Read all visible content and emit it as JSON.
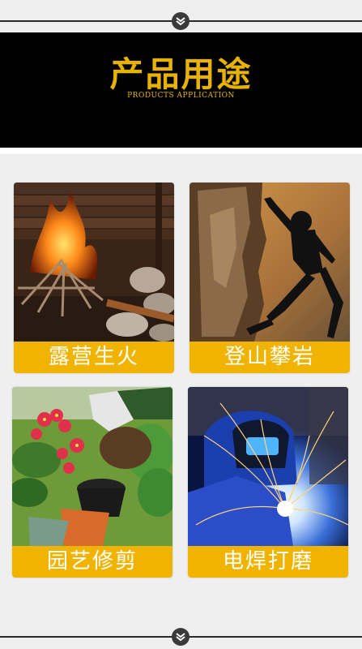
{
  "header": {
    "title": "产品用途",
    "subtitle": "PRODUCTS APPLICATION"
  },
  "cards": [
    {
      "label": "露营生火",
      "icon": "campfire-photo"
    },
    {
      "label": "登山攀岩",
      "icon": "rock-climbing-photo"
    },
    {
      "label": "园艺修剪",
      "icon": "gardening-photo"
    },
    {
      "label": "电焊打磨",
      "icon": "welding-photo"
    }
  ],
  "colors": {
    "accent": "#f0b400",
    "banner_bg": "#000000",
    "title_color": "#e8b200"
  }
}
